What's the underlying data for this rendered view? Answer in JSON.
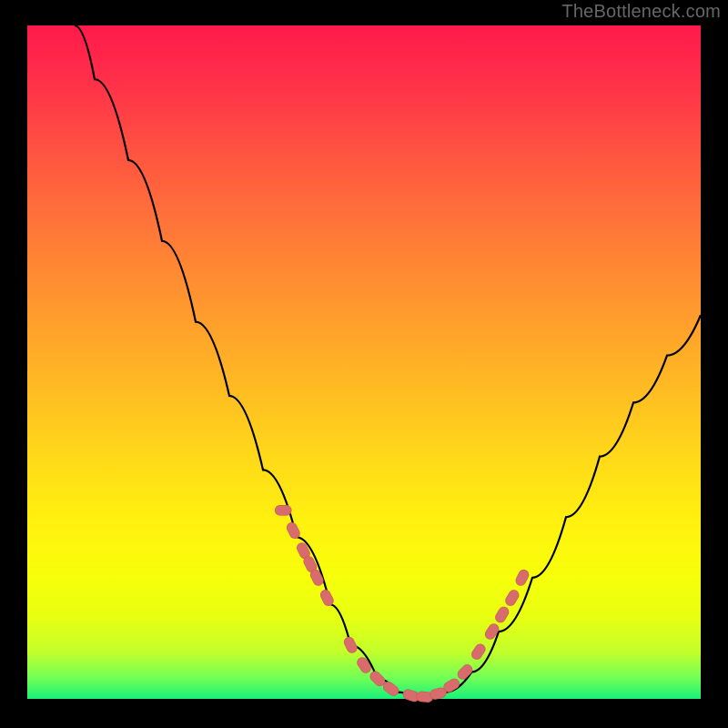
{
  "watermark": "TheBottleneck.com",
  "chart_data": {
    "type": "line",
    "title": "",
    "xlabel": "",
    "ylabel": "",
    "xlim": [
      0,
      100
    ],
    "ylim": [
      0,
      100
    ],
    "grid": false,
    "legend": false,
    "background": {
      "gradient_direction": "vertical",
      "stops": [
        {
          "pos": 0,
          "color": "#ff1a4b"
        },
        {
          "pos": 35,
          "color": "#ff8534"
        },
        {
          "pos": 63,
          "color": "#ffd61a"
        },
        {
          "pos": 88,
          "color": "#e7ff12"
        },
        {
          "pos": 100,
          "color": "#18f07a"
        }
      ]
    },
    "series": [
      {
        "name": "bottleneck-curve",
        "type": "line",
        "x": [
          7,
          10,
          15,
          20,
          25,
          30,
          35,
          40,
          45,
          48,
          52,
          55,
          58,
          62,
          66,
          70,
          75,
          80,
          85,
          90,
          95,
          100
        ],
        "y": [
          100,
          92,
          80,
          68,
          56,
          45,
          34,
          24,
          14,
          8,
          3,
          1,
          0,
          1,
          4,
          10,
          18,
          27,
          36,
          44,
          51,
          57
        ]
      },
      {
        "name": "highlight-markers",
        "type": "scatter",
        "x": [
          38,
          39.5,
          41,
          42,
          43,
          44.5,
          48,
          50,
          52,
          54,
          57,
          59,
          61,
          63,
          65,
          67,
          69,
          70.5,
          72,
          73.5
        ],
        "y": [
          28,
          25,
          22,
          20,
          18,
          15,
          8,
          5,
          3,
          1.5,
          0.5,
          0.3,
          0.8,
          2,
          4,
          7,
          10,
          12.5,
          15,
          18
        ]
      }
    ]
  }
}
